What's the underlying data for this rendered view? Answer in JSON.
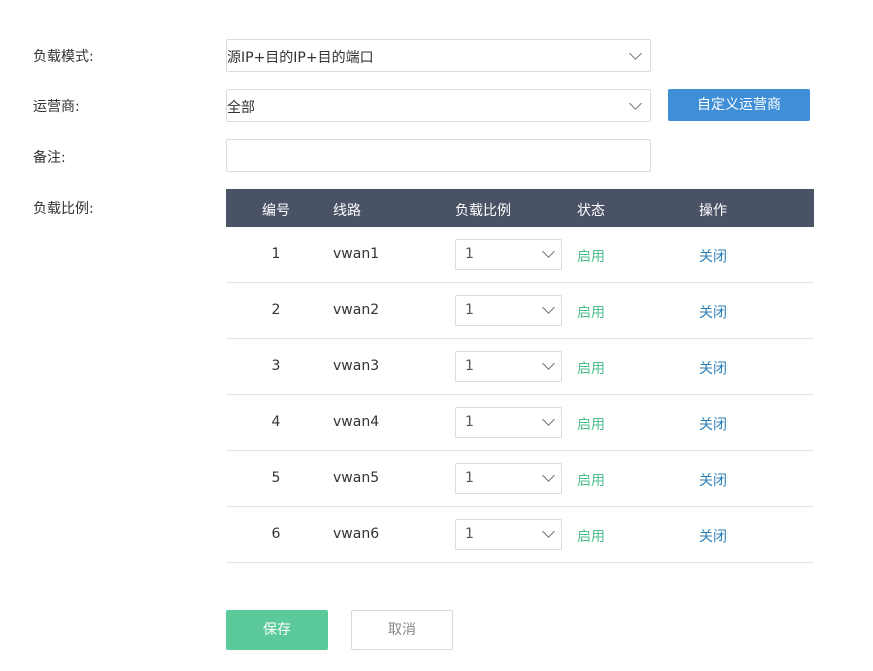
{
  "form": {
    "load_mode_label": "负载模式:",
    "load_mode_value": "源IP+目的IP+目的端口",
    "isp_label": "运营商:",
    "isp_value": "全部",
    "custom_isp_button": "自定义运营商",
    "remark_label": "备注:",
    "remark_value": "",
    "ratio_label": "负载比例:"
  },
  "table": {
    "headers": [
      "编号",
      "线路",
      "负载比例",
      "状态",
      "操作"
    ],
    "rows": [
      {
        "num": "1",
        "line": "vwan1",
        "ratio": "1",
        "status": "启用",
        "action": "关闭"
      },
      {
        "num": "2",
        "line": "vwan2",
        "ratio": "1",
        "status": "启用",
        "action": "关闭"
      },
      {
        "num": "3",
        "line": "vwan3",
        "ratio": "1",
        "status": "启用",
        "action": "关闭"
      },
      {
        "num": "4",
        "line": "vwan4",
        "ratio": "1",
        "status": "启用",
        "action": "关闭"
      },
      {
        "num": "5",
        "line": "vwan5",
        "ratio": "1",
        "status": "启用",
        "action": "关闭"
      },
      {
        "num": "6",
        "line": "vwan6",
        "ratio": "1",
        "status": "启用",
        "action": "关闭"
      }
    ]
  },
  "actions": {
    "save": "保存",
    "cancel": "取消"
  },
  "colors": {
    "header_bg": "#4a5266",
    "accent_blue": "#3f8ed8",
    "status_green": "#4cc08d",
    "link_blue": "#2a7fb8",
    "save_green": "#5cc99a"
  }
}
